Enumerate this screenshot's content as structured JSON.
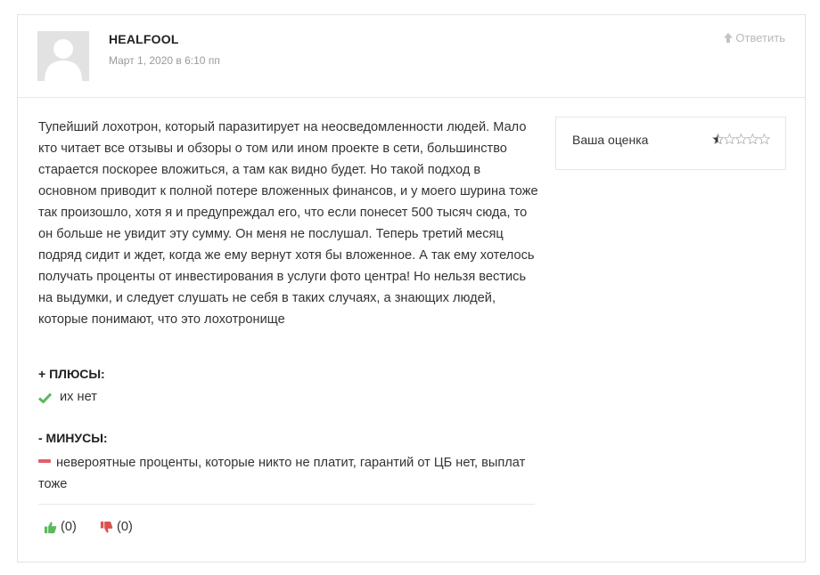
{
  "comment": {
    "author": "HEALFOOL",
    "date": "Март 1, 2020 в 6:10 пп",
    "reply_label": "Ответить",
    "text": "Тупейший лохотрон, который паразитирует на неосведомленности людей. Мало кто читает все отзывы и обзоры о том или ином проекте в сети, большинство старается поскорее вложиться, а там как видно будет. Но такой подход в основном приводит к полной потере вложенных финансов, и у моего шурина тоже так произошло, хотя я и предупреждал его, что если понесет 500 тысяч сюда, то он больше не увидит эту сумму. Он меня не послушал. Теперь третий месяц подряд сидит и ждет, когда же ему вернут хотя бы вложенное. А так ему хотелось получать проценты от инвестирования в услуги фото центра! Но нельзя вестись на выдумки, и следует слушать не себя в таких случаях, а знающих людей, которые понимают, что это лохотронище",
    "rating": {
      "label": "Ваша оценка",
      "value": 0.5,
      "max": 5,
      "filled_color": "#333333",
      "empty_color": "#aaaaaa"
    },
    "pros": {
      "title": "+ ПЛЮСЫ:",
      "text": "их нет",
      "icon": "check-icon",
      "icon_color": "#5cb85c"
    },
    "cons": {
      "title": "- МИНУСЫ:",
      "text": "невероятные проценты, которые никто не платит, гарантий от ЦБ нет, выплат тоже",
      "icon": "minus-icon",
      "icon_color": "#e35d6a"
    },
    "votes": {
      "up_count": "(0)",
      "down_count": "(0)",
      "up_color": "#5cb85c",
      "down_color": "#d9534f"
    }
  }
}
